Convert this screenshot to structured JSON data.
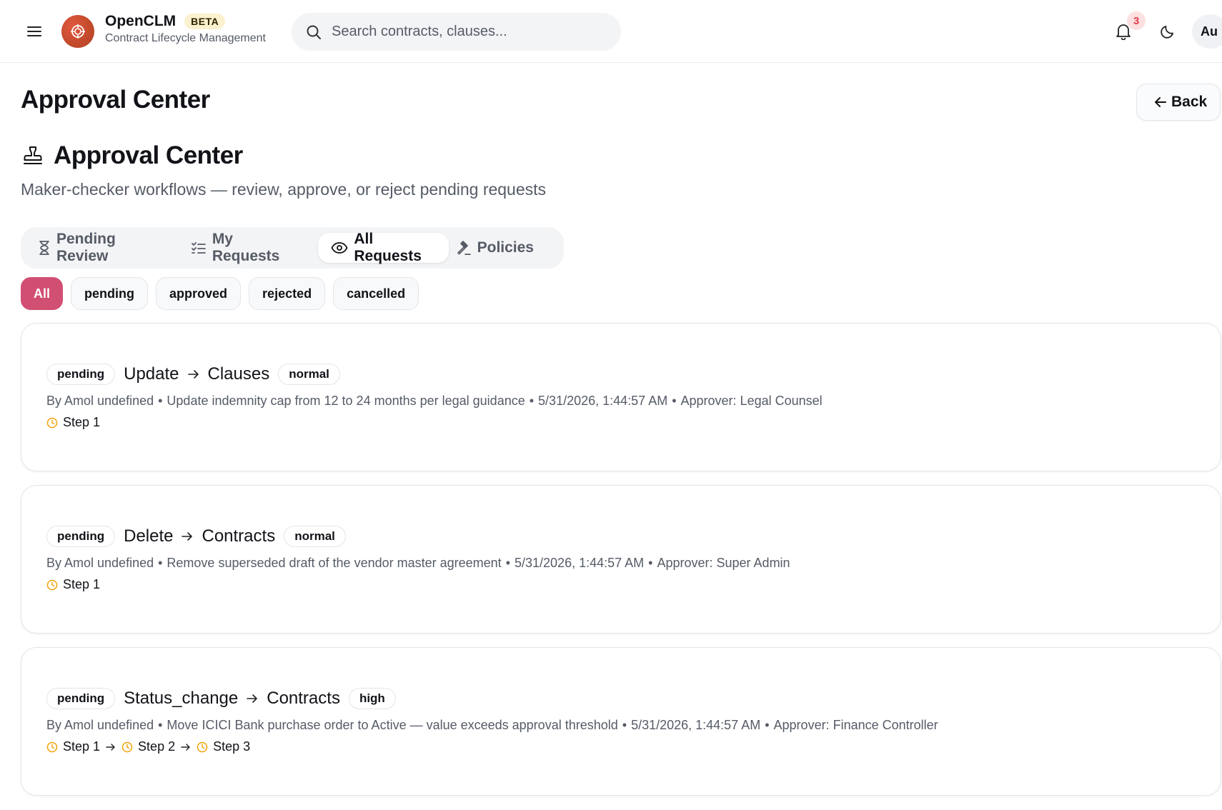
{
  "header": {
    "brand_name": "OpenCLM",
    "beta_label": "BETA",
    "brand_sub": "Contract Lifecycle Management",
    "search_placeholder": "Search contracts, clauses...",
    "notification_count": "3",
    "avatar_initials": "Au"
  },
  "page": {
    "title": "Approval Center",
    "back_label": "Back",
    "section_title": "Approval Center",
    "section_sub": "Maker-checker workflows — review, approve, or reject pending requests"
  },
  "tabs": [
    {
      "label": "Pending Review",
      "icon": "hourglass-icon"
    },
    {
      "label": "My Requests",
      "icon": "list-checks-icon"
    },
    {
      "label": "All Requests",
      "icon": "eye-icon",
      "active": true
    },
    {
      "label": "Policies",
      "icon": "gavel-icon"
    }
  ],
  "filters": [
    {
      "label": "All",
      "active": true
    },
    {
      "label": "pending"
    },
    {
      "label": "approved"
    },
    {
      "label": "rejected"
    },
    {
      "label": "cancelled"
    }
  ],
  "requests": [
    {
      "status": "pending",
      "action": "Update",
      "entity": "Clauses",
      "priority": "normal",
      "by": "By Amol undefined",
      "description": "Update indemnity cap from 12 to 24 months per legal guidance",
      "timestamp": "5/31/2026, 1:44:57 AM",
      "approver": "Approver: Legal Counsel",
      "steps": [
        "Step 1"
      ]
    },
    {
      "status": "pending",
      "action": "Delete",
      "entity": "Contracts",
      "priority": "normal",
      "by": "By Amol undefined",
      "description": "Remove superseded draft of the vendor master agreement",
      "timestamp": "5/31/2026, 1:44:57 AM",
      "approver": "Approver: Super Admin",
      "steps": [
        "Step 1"
      ]
    },
    {
      "status": "pending",
      "action": "Status_change",
      "entity": "Contracts",
      "priority": "high",
      "by": "By Amol undefined",
      "description": "Move ICICI Bank purchase order to Active — value exceeds approval threshold",
      "timestamp": "5/31/2026, 1:44:57 AM",
      "approver": "Approver: Finance Controller",
      "steps": [
        "Step 1",
        "Step 2",
        "Step 3"
      ]
    }
  ],
  "colors": {
    "accent": "#d14f72",
    "step_clock": "#f0a30a",
    "badge_bg": "#fde0e0",
    "badge_text": "#e2404e"
  }
}
